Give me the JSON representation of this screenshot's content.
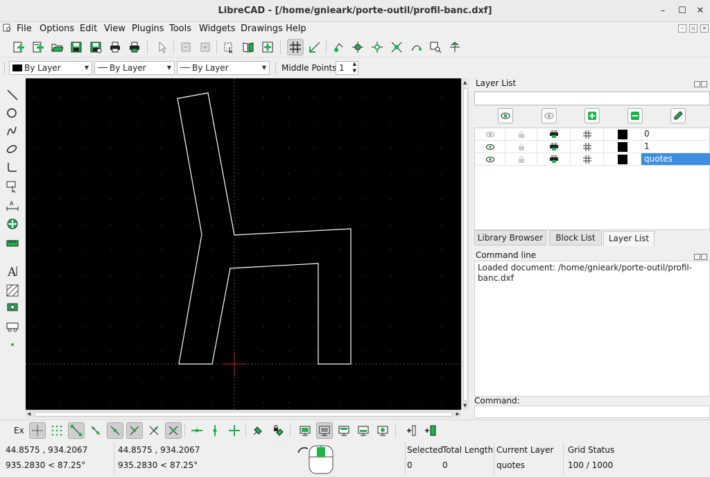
{
  "window": {
    "title": "LibreCAD - [/home/gnieark/porte-outil/profil-banc.dxf]",
    "minimize": "–",
    "maximize": "☐",
    "close": "✕"
  },
  "menu": [
    "File",
    "Options",
    "Edit",
    "View",
    "Plugins",
    "Tools",
    "Widgets",
    "Drawings",
    "Help"
  ],
  "pen_toolbar": {
    "color": "By Layer",
    "width": "By Layer",
    "linetype": "By Layer",
    "middle_points_label": "Middle Points",
    "middle_points_value": "1"
  },
  "layer_list": {
    "title": "Layer List",
    "filter_placeholder": "",
    "layers": [
      {
        "name": "0",
        "selected": false,
        "visible": false
      },
      {
        "name": "1",
        "selected": false,
        "visible": true
      },
      {
        "name": "quotes",
        "selected": true,
        "visible": true
      }
    ]
  },
  "tabs": [
    "Library Browser",
    "Block List",
    "Layer List"
  ],
  "command_line": {
    "title": "Command line",
    "output": "Loaded document: /home/gnieark/porte-outil/profil-banc.dxf",
    "prompt": "Command:"
  },
  "snap_toolbar": {
    "ex_label": "Ex"
  },
  "status": {
    "abs_coord": "44.8575 , 934.2067",
    "abs_polar": "935.2830 < 87.25°",
    "rel_coord": "44.8575 , 934.2067",
    "rel_polar": "935.2830 < 87.25°",
    "selected_label": "Selected",
    "selected_value": "0",
    "total_length_label": "Total Length",
    "total_length_value": "0",
    "current_layer_label": "Current Layer",
    "current_layer_value": "quotes",
    "grid_status_label": "Grid Status",
    "grid_status_value": "100 / 1000"
  },
  "colors": {
    "accent_green": "#1bb34a",
    "selection_blue": "#3d8ee0",
    "canvas_bg": "#000000",
    "cursor_red": "#e02020"
  }
}
